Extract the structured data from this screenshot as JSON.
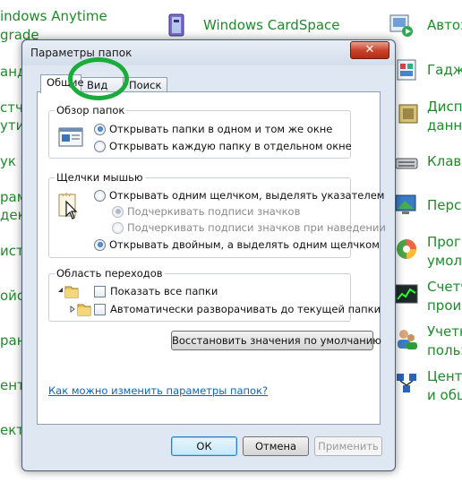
{
  "background": {
    "left_items": [
      "indows Anytime",
      "grade",
      "анд",
      "стчи",
      "утие",
      "ук",
      "рам",
      "декс",
      "истр",
      "ойст",
      "ран",
      "ентр",
      "ектр"
    ],
    "center_item": "Windows CardSpace",
    "right_items": [
      "Автоз",
      "Гадж",
      "Дисп",
      "данны",
      "Клави",
      "Персо",
      "Прогр",
      "умолч",
      "Счетч",
      "произ",
      "Учетн",
      "польз",
      "Центр",
      "и общ"
    ]
  },
  "dialog": {
    "title": "Параметры папок",
    "close_glyph": "✕",
    "tabs": [
      "Общие",
      "Вид",
      "Поиск"
    ],
    "browse_group": {
      "label": "Обзор папок",
      "options": [
        {
          "label": "Открывать папки в одном и том же окне",
          "checked": true
        },
        {
          "label": "Открывать каждую папку в отдельном окне",
          "checked": false
        }
      ]
    },
    "click_group": {
      "label": "Щелчки мышью",
      "options": [
        {
          "label": "Открывать одним щелчком, выделять указателем",
          "checked": false
        },
        {
          "label": "Подчеркивать подписи значков",
          "checked": true,
          "disabled": true
        },
        {
          "label": "Подчеркивать подписи значков при наведении",
          "checked": false,
          "disabled": true
        },
        {
          "label": "Открывать двойным, а выделять одним щелчком",
          "checked": true
        }
      ]
    },
    "nav_group": {
      "label": "Область переходов",
      "options": [
        {
          "label": "Показать все папки",
          "checked": false
        },
        {
          "label": "Автоматически разворачивать до текущей папки",
          "checked": false
        }
      ]
    },
    "restore_button": "Восстановить значения по умолчанию",
    "help_link": "Как можно изменить параметры папок?",
    "ok_button": "ОК",
    "cancel_button": "Отмена",
    "apply_button": "Применить"
  },
  "colors": {
    "link_green": "#1e8a2a",
    "highlight_circle": "#1aab3a",
    "close_red": "#c9442c"
  },
  "icons": {
    "window_preview": "folder-window-icon",
    "cursor": "click-cursor-icon",
    "folder": "folder-icon"
  }
}
